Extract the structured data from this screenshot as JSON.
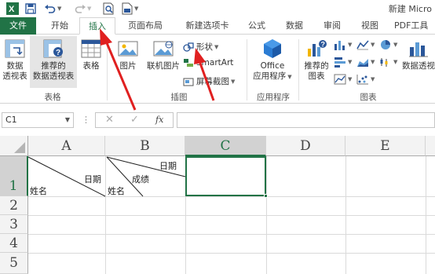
{
  "app": {
    "title": "新建 Micro"
  },
  "colors": {
    "accent": "#217346",
    "arrow": "#e02020"
  },
  "ribbon_tabs": [
    {
      "label": "文件"
    },
    {
      "label": "开始"
    },
    {
      "label": "插入"
    },
    {
      "label": "页面布局"
    },
    {
      "label": "新建选项卡"
    },
    {
      "label": "公式"
    },
    {
      "label": "数据"
    },
    {
      "label": "审阅"
    },
    {
      "label": "视图"
    },
    {
      "label": "PDF工具"
    }
  ],
  "groups": {
    "tables": {
      "label": "表格",
      "pivot_line1": "数据",
      "pivot_line2": "透视表",
      "rec_pivot_line1": "推荐的",
      "rec_pivot_line2": "数据透视表",
      "table": "表格"
    },
    "illustrations": {
      "label": "插图",
      "pictures": "图片",
      "online_pictures": "联机图片",
      "shapes": "形状",
      "smartart": "SmartArt",
      "screenshot": "屏幕截图"
    },
    "apps": {
      "label": "应用程序",
      "office_line1": "Office",
      "office_line2": "应用程序"
    },
    "charts": {
      "label": "图表",
      "rec_charts_line1": "推荐的",
      "rec_charts_line2": "图表",
      "pivot_chart_line1": "数据透视"
    }
  },
  "formula_bar": {
    "name_box": "C1",
    "fx": "fx",
    "value": ""
  },
  "sheet": {
    "columns": [
      "A",
      "B",
      "C",
      "D",
      "E"
    ],
    "rows": [
      "1",
      "2",
      "3",
      "4",
      "5"
    ],
    "cells": {
      "a1_top": "日期",
      "a1_bottom": "姓名",
      "b1_top": "日期",
      "b1_mid": "成绩",
      "b1_bottom": "姓名"
    },
    "selected": "C1"
  }
}
